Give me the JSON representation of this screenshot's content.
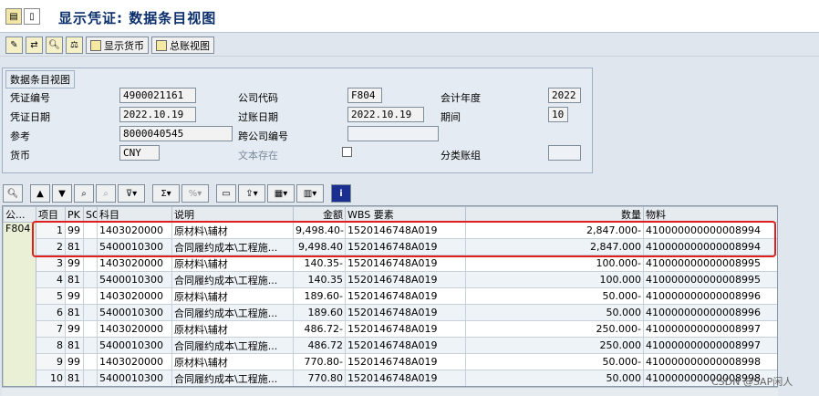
{
  "window": {
    "title": "显示凭证: 数据条目视图"
  },
  "toolbar": {
    "currency_btn": "显示货币",
    "ledger_btn": "总账视图"
  },
  "header": {
    "tab": "数据条目视图",
    "doc_no_label": "凭证编号",
    "doc_no": "4900021161",
    "company_label": "公司代码",
    "company": "F804",
    "fiscal_year_label": "会计年度",
    "fiscal_year": "2022",
    "doc_date_label": "凭证日期",
    "doc_date": "2022.10.19",
    "post_date_label": "过账日期",
    "post_date": "2022.10.19",
    "period_label": "期间",
    "period": "10",
    "ref_label": "参考",
    "ref": "8000040545",
    "cross_company_label": "跨公司编号",
    "cross_company": "",
    "currency_label": "货币",
    "currency": "CNY",
    "text_exists_label": "文本存在",
    "ledger_group_label": "分类账组",
    "ledger_group": ""
  },
  "grid": {
    "columns": [
      "公...",
      "项目",
      "PK",
      "SG",
      "科目",
      "说明",
      "金额",
      "WBS 要素",
      "数量",
      "物料"
    ],
    "company_group": "F804",
    "rows": [
      {
        "item": "1",
        "pk": "99",
        "sg": "",
        "account": "1403020000",
        "desc": "原材料\\辅材",
        "amount": "9,498.40-",
        "wbs": "1520146748A019",
        "qty": "2,847.000-",
        "material": "410000000000008994"
      },
      {
        "item": "2",
        "pk": "81",
        "sg": "",
        "account": "5400010300",
        "desc": "合同履约成本\\工程施...",
        "amount": "9,498.40",
        "wbs": "1520146748A019",
        "qty": "2,847.000",
        "material": "410000000000008994"
      },
      {
        "item": "3",
        "pk": "99",
        "sg": "",
        "account": "1403020000",
        "desc": "原材料\\辅材",
        "amount": "140.35-",
        "wbs": "1520146748A019",
        "qty": "100.000-",
        "material": "410000000000008995"
      },
      {
        "item": "4",
        "pk": "81",
        "sg": "",
        "account": "5400010300",
        "desc": "合同履约成本\\工程施...",
        "amount": "140.35",
        "wbs": "1520146748A019",
        "qty": "100.000",
        "material": "410000000000008995"
      },
      {
        "item": "5",
        "pk": "99",
        "sg": "",
        "account": "1403020000",
        "desc": "原材料\\辅材",
        "amount": "189.60-",
        "wbs": "1520146748A019",
        "qty": "50.000-",
        "material": "410000000000008996"
      },
      {
        "item": "6",
        "pk": "81",
        "sg": "",
        "account": "5400010300",
        "desc": "合同履约成本\\工程施...",
        "amount": "189.60",
        "wbs": "1520146748A019",
        "qty": "50.000",
        "material": "410000000000008996"
      },
      {
        "item": "7",
        "pk": "99",
        "sg": "",
        "account": "1403020000",
        "desc": "原材料\\辅材",
        "amount": "486.72-",
        "wbs": "1520146748A019",
        "qty": "250.000-",
        "material": "410000000000008997"
      },
      {
        "item": "8",
        "pk": "81",
        "sg": "",
        "account": "5400010300",
        "desc": "合同履约成本\\工程施...",
        "amount": "486.72",
        "wbs": "1520146748A019",
        "qty": "250.000",
        "material": "410000000000008997"
      },
      {
        "item": "9",
        "pk": "99",
        "sg": "",
        "account": "1403020000",
        "desc": "原材料\\辅材",
        "amount": "770.80-",
        "wbs": "1520146748A019",
        "qty": "50.000-",
        "material": "410000000000008998"
      },
      {
        "item": "10",
        "pk": "81",
        "sg": "",
        "account": "5400010300",
        "desc": "合同履约成本\\工程施...",
        "amount": "770.80",
        "wbs": "1520146748A019",
        "qty": "50.000",
        "material": "410000000000008998"
      }
    ]
  },
  "watermark": "CSDN @SAP闲人"
}
